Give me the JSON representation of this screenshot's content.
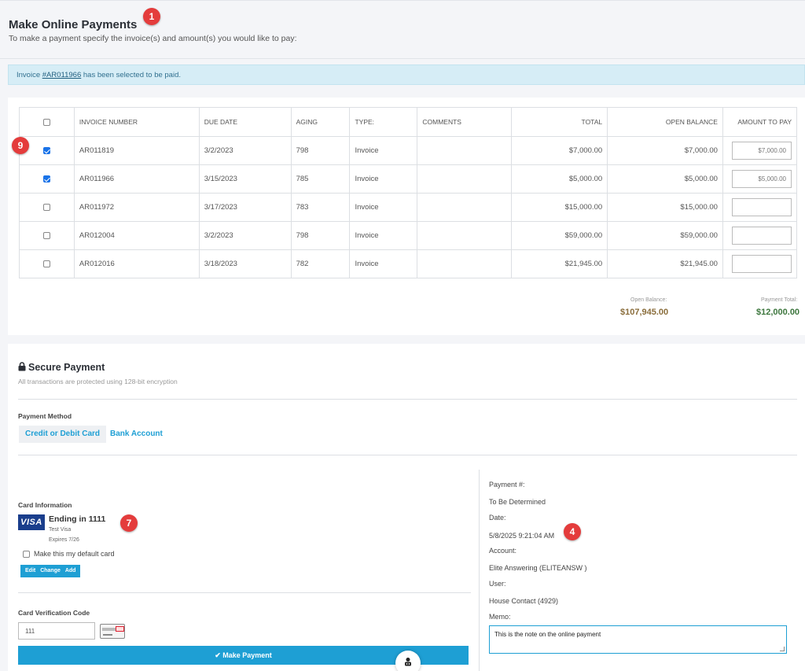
{
  "header": {
    "title": "Make Online Payments",
    "subtitle": "To make a payment specify the invoice(s) and amount(s) you would like to pay:"
  },
  "badges": [
    "1",
    "9",
    "7",
    "4"
  ],
  "alert": {
    "prefix": "Invoice ",
    "link": "#AR011966",
    "suffix": " has been selected to be paid."
  },
  "table": {
    "headers": [
      "INVOICE NUMBER",
      "DUE DATE",
      "AGING",
      "TYPE:",
      "COMMENTS",
      "TOTAL",
      "OPEN BALANCE",
      "AMOUNT TO PAY"
    ],
    "rows": [
      {
        "checked": true,
        "invoice": "AR011819",
        "due": "3/2/2023",
        "aging": "798",
        "type": "Invoice",
        "comments": "",
        "total": "$7,000.00",
        "open": "$7,000.00",
        "amount": "$7,000.00"
      },
      {
        "checked": true,
        "invoice": "AR011966",
        "due": "3/15/2023",
        "aging": "785",
        "type": "Invoice",
        "comments": "",
        "total": "$5,000.00",
        "open": "$5,000.00",
        "amount": "$5,000.00"
      },
      {
        "checked": false,
        "invoice": "AR011972",
        "due": "3/17/2023",
        "aging": "783",
        "type": "Invoice",
        "comments": "",
        "total": "$15,000.00",
        "open": "$15,000.00",
        "amount": ""
      },
      {
        "checked": false,
        "invoice": "AR012004",
        "due": "3/2/2023",
        "aging": "798",
        "type": "Invoice",
        "comments": "",
        "total": "$59,000.00",
        "open": "$59,000.00",
        "amount": ""
      },
      {
        "checked": false,
        "invoice": "AR012016",
        "due": "3/18/2023",
        "aging": "782",
        "type": "Invoice",
        "comments": "",
        "total": "$21,945.00",
        "open": "$21,945.00",
        "amount": ""
      }
    ]
  },
  "totals": {
    "open_label": "Open Balance:",
    "open_value": "$107,945.00",
    "open_color": "#8a6d3b",
    "pay_label": "Payment Total:",
    "pay_value": "$12,000.00",
    "pay_color": "#3c763d"
  },
  "secure": {
    "title": "Secure Payment",
    "subtitle": "All transactions are protected using 128-bit encryption",
    "lock_icon": "lock-icon",
    "method_label": "Payment Method",
    "tabs": [
      "Credit or Debit Card",
      "Bank Account"
    ],
    "accent": "#1e9fd4"
  },
  "card": {
    "section_label": "Card Information",
    "brand": "VISA",
    "ending": "Ending in 1111",
    "name": "Test Visa",
    "expires": "Expires 7/26",
    "default_label": "Make this my default card",
    "buttons": [
      "Edit",
      "Change",
      "Add"
    ],
    "cvc_label": "Card Verification Code",
    "cvc_value": "111",
    "submit": "Make Payment"
  },
  "info": {
    "payment_label": "Payment #:",
    "payment_value": "To Be Determined",
    "date_label": "Date:",
    "date_value": "5/8/2025 9:21:04 AM",
    "account_label": "Account:",
    "account_value": "Elite Answering (ELITEANSW )",
    "user_label": "User:",
    "user_value": "House Contact (4929)",
    "memo_label": "Memo:",
    "memo_value": "This is the note on the online payment"
  }
}
